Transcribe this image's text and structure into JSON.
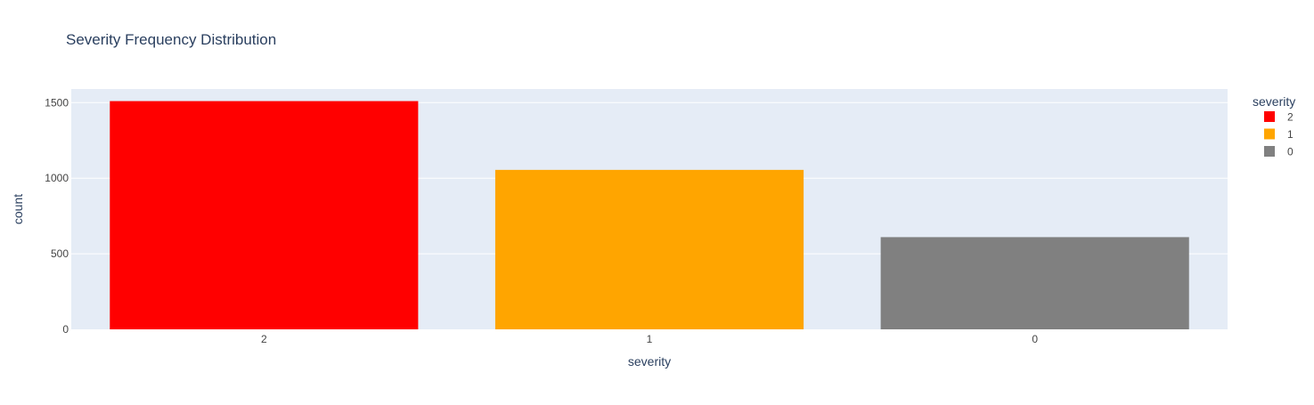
{
  "chart_data": {
    "type": "bar",
    "title": "Severity Frequency Distribution",
    "xlabel": "severity",
    "ylabel": "count",
    "categories": [
      "2",
      "1",
      "0"
    ],
    "series": [
      {
        "name": "2",
        "x": "2",
        "value": 1510,
        "color": "#ff0000"
      },
      {
        "name": "1",
        "x": "1",
        "value": 1055,
        "color": "#ffa500"
      },
      {
        "name": "0",
        "x": "0",
        "value": 610,
        "color": "#808080"
      }
    ],
    "ylim": [
      0,
      1590
    ],
    "yticks": [
      0,
      500,
      1000,
      1500
    ],
    "legend_title": "severity",
    "legend_position": "right",
    "grid": true,
    "colors": {
      "plot_background": "#e5ecf6",
      "gridline": "#ffffff",
      "text": "#2a3f5f",
      "tick_text": "#444444"
    }
  }
}
